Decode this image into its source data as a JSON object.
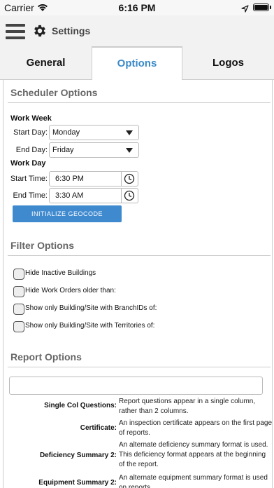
{
  "status_bar": {
    "carrier": "Carrier",
    "time": "6:16 PM",
    "battery_level": 1.0
  },
  "header": {
    "title": "Settings",
    "menu_icon": "hamburger-menu-icon",
    "settings_icon": "gear-icon"
  },
  "tabs": [
    {
      "label": "General",
      "active": false
    },
    {
      "label": "Options",
      "active": true
    },
    {
      "label": "Logos",
      "active": false
    }
  ],
  "scheduler": {
    "title": "Scheduler Options",
    "work_week_label": "Work Week",
    "start_day_label": "Start Day:",
    "start_day_value": "Monday",
    "end_day_label": "End Day:",
    "end_day_value": "Friday",
    "work_day_label": "Work Day",
    "start_time_label": "Start Time:",
    "start_time_value": "6:30 PM",
    "end_time_label": "End Time:",
    "end_time_value": "3:30 AM",
    "geocode_button": "INITIALIZE GEOCODE"
  },
  "filter": {
    "title": "Filter Options",
    "options": [
      {
        "label": "Hide Inactive Buildings",
        "checked": false
      },
      {
        "label": "Hide Work Orders older than:",
        "checked": false
      },
      {
        "label": "Show only Building/Site with BranchIDs of:",
        "checked": false
      },
      {
        "label": "Show only Building/Site with Territories of:",
        "checked": false
      }
    ]
  },
  "report": {
    "title": "Report Options",
    "input_value": "",
    "rows": [
      {
        "label": "Single Col Questions:",
        "description": "Report questions appear in a single column, rather than 2 columns."
      },
      {
        "label": "Certificate:",
        "description": "An inspection certificate appears on the first page of reports."
      },
      {
        "label": "Deficiency Summary 2:",
        "description": "An alternate deficiency summary format is used. This deficiency format appears at the beginning of the report."
      },
      {
        "label": "Equipment Summary 2:",
        "description": "An alternate equipment summary format is used on reports."
      }
    ]
  },
  "colors": {
    "accent": "#3a8ac7",
    "button_bg": "#3f89cf",
    "header_bg": "#f2f2f2"
  }
}
